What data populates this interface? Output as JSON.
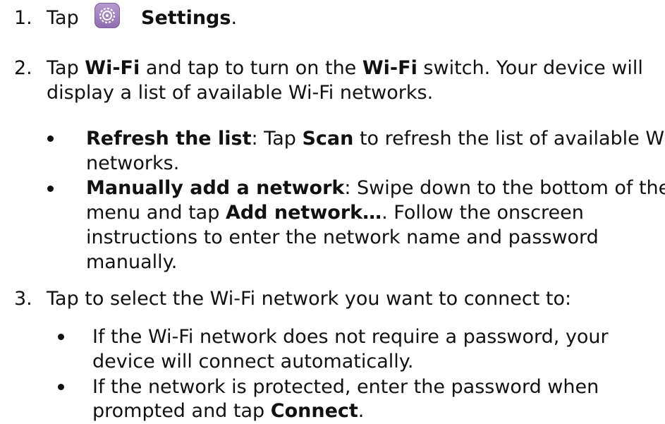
{
  "steps": [
    {
      "number": "1.",
      "tap": "Tap",
      "settings_icon": "gear-icon",
      "settings_label": "Settings",
      "end": "."
    },
    {
      "number": "2.",
      "line1_a": "Tap ",
      "wifi_1": "Wi-Fi",
      "line1_b": " and tap to turn on the ",
      "wifi_2": "Wi-Fi",
      "line1_c": " switch. Your device will",
      "line2": "display a list of available Wi-Fi networks.",
      "bullets": [
        {
          "title": "Refresh the list",
          "line1_a": ": Tap ",
          "scan": "Scan",
          "line1_b": " to refresh the list of available Wi-Fi",
          "line2": "networks."
        },
        {
          "title": "Manually add a network",
          "line1_a": ": Swipe down to the bottom of the",
          "line2_a": "menu and tap ",
          "add_network": "Add network…",
          "line2_b": ". Follow the onscreen",
          "line3": "instructions to enter the network name and password",
          "line4": "manually."
        }
      ]
    },
    {
      "number": "3.",
      "line1": "Tap to select the Wi-Fi network you want to connect to:",
      "bullets": [
        {
          "line1": "If the Wi-Fi network does not require a password, your",
          "line2": "device will connect automatically."
        },
        {
          "line1": "If the network is protected, enter the password when",
          "line2_a": "prompted and tap ",
          "connect": "Connect",
          "line2_b": "."
        }
      ]
    }
  ],
  "colors": {
    "text": "#111111",
    "icon_bg": "#9b7bbb"
  }
}
